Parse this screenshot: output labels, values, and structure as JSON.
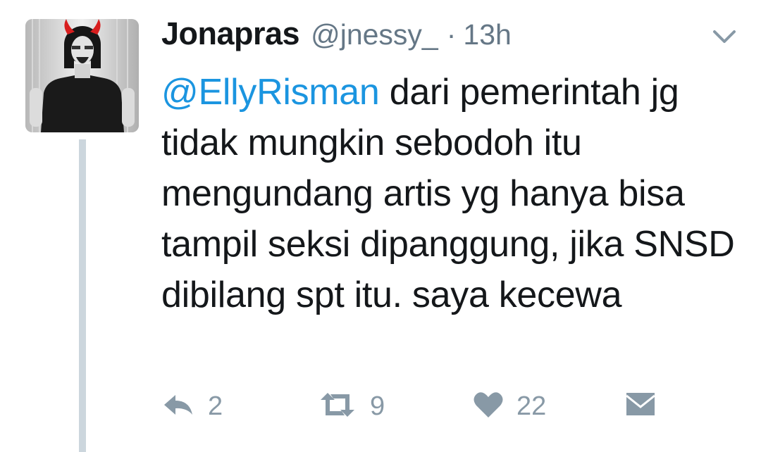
{
  "tweet": {
    "author_name": "Jonapras",
    "author_handle": "@jnessy_",
    "separator": "·",
    "timestamp": "13h",
    "mention": "@EllyRisman",
    "body": " dari pemerintah jg tidak mungkin sebodoh itu mengundang artis yg hanya bisa tampil seksi dipanggung, jika SNSD dibilang spt itu. saya kecewa",
    "counts": {
      "replies": "2",
      "retweets": "9",
      "likes": "22"
    }
  },
  "icons": {
    "menu": "chevron-down-icon",
    "reply": "reply-icon",
    "retweet": "retweet-icon",
    "like": "heart-icon",
    "dm": "envelope-icon"
  },
  "colors": {
    "text": "#14171a",
    "secondary": "#657786",
    "icon": "#8899a6",
    "link": "#1b95e0",
    "thread_line": "#ccd6dd"
  }
}
